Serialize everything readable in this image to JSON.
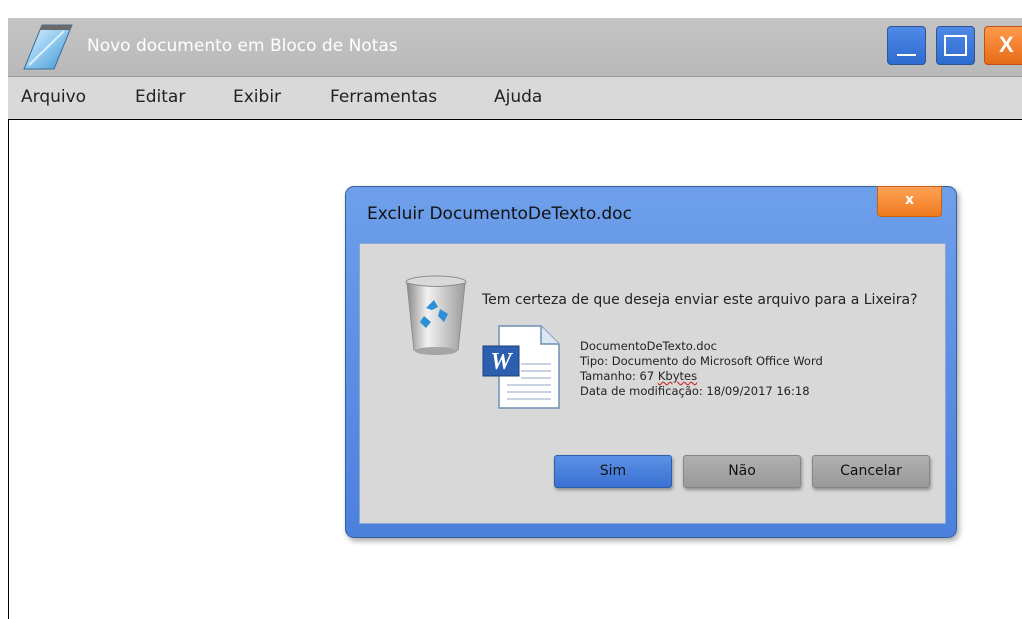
{
  "window": {
    "title": "Novo documento em Bloco de Notas",
    "close_glyph": "X"
  },
  "menu": {
    "items": [
      "Arquivo",
      "Editar",
      "Exibir",
      "Ferramentas",
      "Ajuda"
    ]
  },
  "dialog": {
    "title": "Excluir DocumentoDeTexto.doc",
    "close_glyph": "x",
    "question": "Tem certeza de que deseja enviar este arquivo para a Lixeira?",
    "file": {
      "name": "DocumentoDeTexto.doc",
      "type": "Tipo: Documento do Microsoft Office Word",
      "size_prefix": "Tamanho: 67 ",
      "size_unit": "Kbytes",
      "modified": "Data de modificação: 18/09/2017 16:18"
    },
    "buttons": {
      "yes": "Sim",
      "no": "Não",
      "cancel": "Cancelar"
    }
  },
  "icons": {
    "app": "notepad-icon",
    "trash": "recycle-bin-icon",
    "file": "word-document-icon"
  },
  "colors": {
    "accent_blue": "#4b80dd",
    "close_orange": "#ef7a1e",
    "dialog_body": "#d8d8d8"
  }
}
